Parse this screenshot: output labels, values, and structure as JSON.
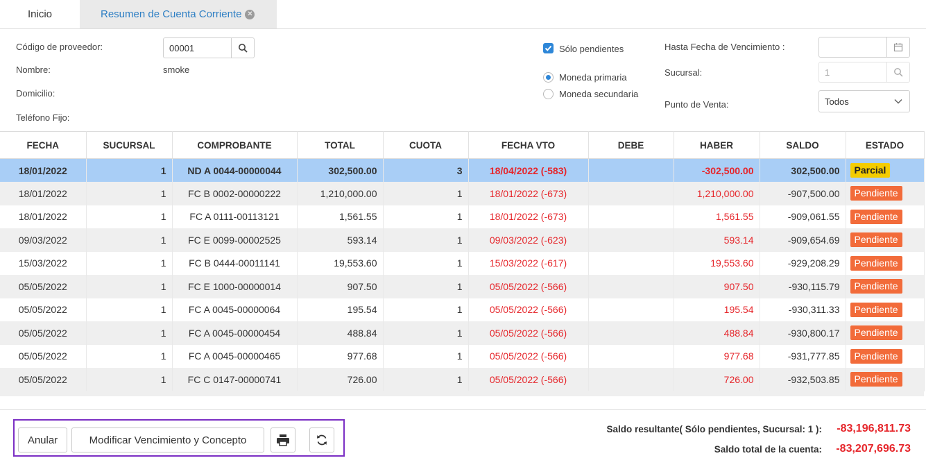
{
  "tabs": [
    {
      "label": "Inicio"
    },
    {
      "label": "Resumen de Cuenta Corriente"
    }
  ],
  "form": {
    "codigo_label": "Código de proveedor:",
    "codigo_value": "00001",
    "nombre_label": "Nombre:",
    "nombre_value": "smoke",
    "domicilio_label": "Domicilio:",
    "telefono_label": "Teléfono Fijo:",
    "solo_pendientes_label": "Sólo pendientes",
    "solo_pendientes_checked": true,
    "moneda_primaria_label": "Moneda primaria",
    "moneda_secundaria_label": "Moneda secundaria",
    "moneda_selected": "primaria",
    "hasta_fecha_label": "Hasta Fecha de Vencimiento :",
    "hasta_fecha_value": "",
    "sucursal_label": "Sucursal:",
    "sucursal_value": "1",
    "punto_venta_label": "Punto de Venta:",
    "punto_venta_value": "Todos"
  },
  "table": {
    "columns": [
      "FECHA",
      "SUCURSAL",
      "COMPROBANTE",
      "TOTAL",
      "CUOTA",
      "FECHA VTO",
      "DEBE",
      "HABER",
      "SALDO",
      "ESTADO"
    ],
    "rows": [
      {
        "fecha": "18/01/2022",
        "sucursal": "1",
        "comprobante": "ND A 0044-00000044",
        "total": "302,500.00",
        "cuota": "3",
        "fecha_vto": "18/04/2022 (-583)",
        "debe": "",
        "haber": "-302,500.00",
        "saldo": "302,500.00",
        "estado": "Parcial"
      },
      {
        "fecha": "18/01/2022",
        "sucursal": "1",
        "comprobante": "FC B 0002-00000222",
        "total": "1,210,000.00",
        "cuota": "1",
        "fecha_vto": "18/01/2022 (-673)",
        "debe": "",
        "haber": "1,210,000.00",
        "saldo": "-907,500.00",
        "estado": "Pendiente"
      },
      {
        "fecha": "18/01/2022",
        "sucursal": "1",
        "comprobante": "FC A 0111-00113121",
        "total": "1,561.55",
        "cuota": "1",
        "fecha_vto": "18/01/2022 (-673)",
        "debe": "",
        "haber": "1,561.55",
        "saldo": "-909,061.55",
        "estado": "Pendiente"
      },
      {
        "fecha": "09/03/2022",
        "sucursal": "1",
        "comprobante": "FC E 0099-00002525",
        "total": "593.14",
        "cuota": "1",
        "fecha_vto": "09/03/2022 (-623)",
        "debe": "",
        "haber": "593.14",
        "saldo": "-909,654.69",
        "estado": "Pendiente"
      },
      {
        "fecha": "15/03/2022",
        "sucursal": "1",
        "comprobante": "FC B 0444-00011141",
        "total": "19,553.60",
        "cuota": "1",
        "fecha_vto": "15/03/2022 (-617)",
        "debe": "",
        "haber": "19,553.60",
        "saldo": "-929,208.29",
        "estado": "Pendiente"
      },
      {
        "fecha": "05/05/2022",
        "sucursal": "1",
        "comprobante": "FC E 1000-00000014",
        "total": "907.50",
        "cuota": "1",
        "fecha_vto": "05/05/2022 (-566)",
        "debe": "",
        "haber": "907.50",
        "saldo": "-930,115.79",
        "estado": "Pendiente"
      },
      {
        "fecha": "05/05/2022",
        "sucursal": "1",
        "comprobante": "FC A 0045-00000064",
        "total": "195.54",
        "cuota": "1",
        "fecha_vto": "05/05/2022 (-566)",
        "debe": "",
        "haber": "195.54",
        "saldo": "-930,311.33",
        "estado": "Pendiente"
      },
      {
        "fecha": "05/05/2022",
        "sucursal": "1",
        "comprobante": "FC A 0045-00000454",
        "total": "488.84",
        "cuota": "1",
        "fecha_vto": "05/05/2022 (-566)",
        "debe": "",
        "haber": "488.84",
        "saldo": "-930,800.17",
        "estado": "Pendiente"
      },
      {
        "fecha": "05/05/2022",
        "sucursal": "1",
        "comprobante": "FC A 0045-00000465",
        "total": "977.68",
        "cuota": "1",
        "fecha_vto": "05/05/2022 (-566)",
        "debe": "",
        "haber": "977.68",
        "saldo": "-931,777.85",
        "estado": "Pendiente"
      },
      {
        "fecha": "05/05/2022",
        "sucursal": "1",
        "comprobante": "FC C 0147-00000741",
        "total": "726.00",
        "cuota": "1",
        "fecha_vto": "05/05/2022 (-566)",
        "debe": "",
        "haber": "726.00",
        "saldo": "-932,503.85",
        "estado": "Pendiente"
      }
    ]
  },
  "actions": {
    "anular_label": "Anular",
    "modificar_label": "Modificar Vencimiento y Concepto"
  },
  "summary": {
    "saldo_resultante_label": "Saldo resultante( Sólo pendientes, Sucursal: 1 ):",
    "saldo_resultante_value": "-83,196,811.73",
    "saldo_total_label": "Saldo total de la cuenta:",
    "saldo_total_value": "-83,207,696.73"
  },
  "colors": {
    "accent": "#2e87d8",
    "selected_row": "#a9cef6",
    "negative": "#e6262b",
    "pendiente_badge": "#f26b3a",
    "parcial_badge": "#f4cc00",
    "button_group_border": "#7b2fc4"
  }
}
